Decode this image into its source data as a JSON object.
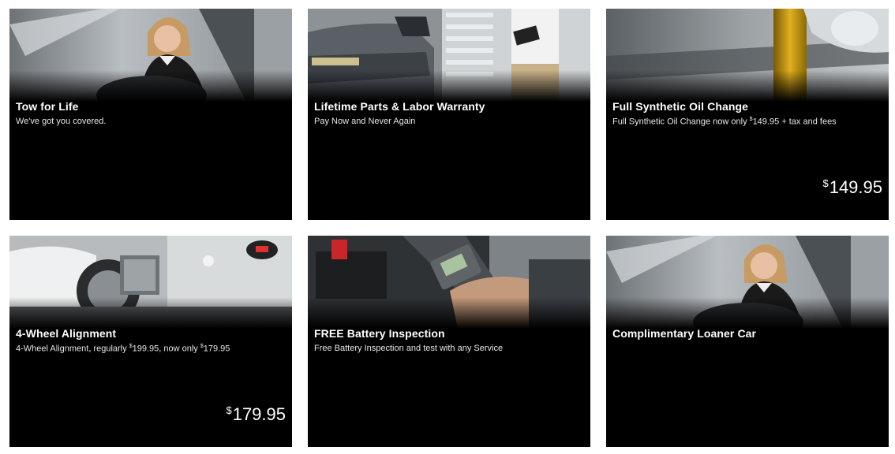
{
  "offers": [
    {
      "title": "Tow for Life",
      "desc": "We've got you covered.",
      "image": "woman-driving-car-photo"
    },
    {
      "title": "Lifetime Parts & Labor Warranty",
      "desc": "Pay Now and Never Again",
      "image": "car-and-advisor-tablet-photo"
    },
    {
      "title": "Full Synthetic Oil Change",
      "desc_pre": "Full Synthetic Oil Change now only ",
      "desc_cur": "$",
      "desc_amt": "149.95",
      "desc_post": " + tax and fees",
      "price_cur": "$",
      "price_amt": "149.95",
      "image": "oil-pouring-photo"
    },
    {
      "title": "4-Wheel Alignment",
      "desc_pre": "4-Wheel Alignment, regularly ",
      "desc_cur1": "$",
      "desc_amt1": "199.95",
      "desc_mid": ", now only ",
      "desc_cur2": "$",
      "desc_amt2": "179.95",
      "price_cur": "$",
      "price_amt": "179.95",
      "image": "wheel-alignment-machine-photo"
    },
    {
      "title": "FREE Battery Inspection",
      "desc": "Free Battery Inspection and test with any Service",
      "image": "battery-tester-photo"
    },
    {
      "title": "Complimentary Loaner Car",
      "image": "woman-driving-car-photo"
    }
  ]
}
